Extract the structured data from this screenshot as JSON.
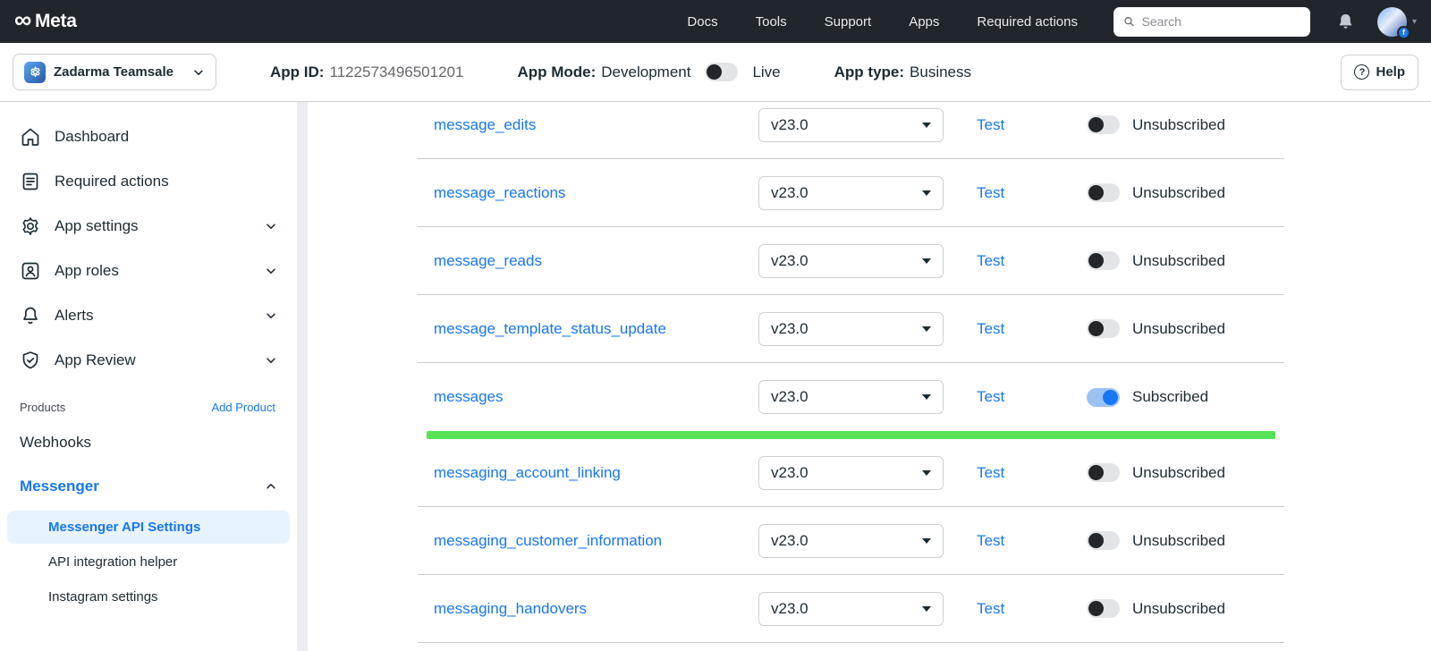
{
  "topnav": {
    "brand": "Meta",
    "items": [
      "Docs",
      "Tools",
      "Support",
      "Apps",
      "Required actions"
    ],
    "search_placeholder": "Search"
  },
  "appbar": {
    "app_name": "Zadarma Teamsale",
    "app_id_label": "App ID:",
    "app_id": "1122573496501201",
    "app_mode_label": "App Mode:",
    "app_mode_value": "Development",
    "live_label": "Live",
    "app_type_label": "App type:",
    "app_type_value": "Business",
    "help_label": "Help"
  },
  "sidebar": {
    "items": [
      {
        "label": "Dashboard",
        "chevron": false
      },
      {
        "label": "Required actions",
        "chevron": false
      },
      {
        "label": "App settings",
        "chevron": true
      },
      {
        "label": "App roles",
        "chevron": true
      },
      {
        "label": "Alerts",
        "chevron": true
      },
      {
        "label": "App Review",
        "chevron": true
      }
    ],
    "products_label": "Products",
    "add_product_label": "Add Product",
    "webhooks_label": "Webhooks",
    "messenger_label": "Messenger",
    "messenger_items": [
      {
        "label": "Messenger API Settings",
        "active": true
      },
      {
        "label": "API integration helper",
        "active": false
      },
      {
        "label": "Instagram settings",
        "active": false
      }
    ]
  },
  "table": {
    "rows": [
      {
        "field": "message_edits",
        "version": "v23.0",
        "test": "Test",
        "subscribed": false,
        "status": "Unsubscribed",
        "highlight_bar": false
      },
      {
        "field": "message_reactions",
        "version": "v23.0",
        "test": "Test",
        "subscribed": false,
        "status": "Unsubscribed",
        "highlight_bar": false
      },
      {
        "field": "message_reads",
        "version": "v23.0",
        "test": "Test",
        "subscribed": false,
        "status": "Unsubscribed",
        "highlight_bar": false
      },
      {
        "field": "message_template_status_update",
        "version": "v23.0",
        "test": "Test",
        "subscribed": false,
        "status": "Unsubscribed",
        "highlight_bar": false
      },
      {
        "field": "messages",
        "version": "v23.0",
        "test": "Test",
        "subscribed": true,
        "status": "Subscribed",
        "highlight_bar": true
      },
      {
        "field": "messaging_account_linking",
        "version": "v23.0",
        "test": "Test",
        "subscribed": false,
        "status": "Unsubscribed",
        "highlight_bar": false
      },
      {
        "field": "messaging_customer_information",
        "version": "v23.0",
        "test": "Test",
        "subscribed": false,
        "status": "Unsubscribed",
        "highlight_bar": false
      },
      {
        "field": "messaging_handovers",
        "version": "v23.0",
        "test": "Test",
        "subscribed": false,
        "status": "Unsubscribed",
        "highlight_bar": false
      }
    ]
  },
  "colors": {
    "accent_blue": "#1877f2",
    "highlight_green": "#58e258",
    "nav_dark": "#20262b",
    "active_item_bg": "#e7f3ff"
  }
}
